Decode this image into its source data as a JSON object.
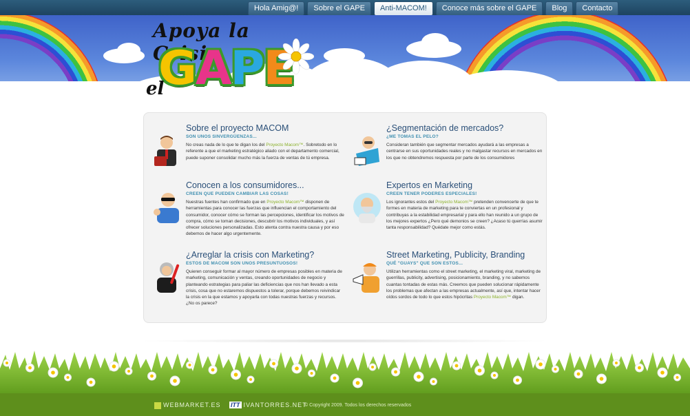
{
  "nav": {
    "items": [
      {
        "label": "Hola Amig@!"
      },
      {
        "label": "Sobre el GAPE"
      },
      {
        "label": "Anti-MACOM!"
      },
      {
        "label": "Conoce más sobre el GAPE"
      },
      {
        "label": "Blog"
      },
      {
        "label": "Contacto"
      }
    ],
    "active_index": 2
  },
  "logo": {
    "line1": "Apoya la Crisis",
    "prefix": "el",
    "word": "GAPE"
  },
  "items": [
    {
      "title": "Sobre el proyecto MACOM",
      "subtitle": "SON UNOS SINVERGÜENZAS...",
      "text_before": "No creas nada de lo que te digan los del ",
      "highlight": "Proyecto Macom™",
      "text_after": ". Sobretodo en lo referente a que el marketing estratégico aliado con el departamento comercial, puede suponer consolidar mucho más la fuerza de ventas de tú empresa."
    },
    {
      "title": "¿Segmentación de mercados?",
      "subtitle": "¿ME TOMAS EL PELO?",
      "text_before": "Consideran también que segmentar mercados ayudará a las empresas a centrarse en sus oportunidades reales y no malgastar recursos en mercados en los que no obtendremos respuesta por parte de los consumidores",
      "highlight": "",
      "text_after": ""
    },
    {
      "title": "Conocen a los consumidores...",
      "subtitle": "CREEN QUE PUEDEN CAMBIAR LAS COSAS!",
      "text_before": "Nuestras fuentes han confirmado que en ",
      "highlight": "Proyecto Macom™",
      "text_after": " disponen de herramientas para conocer las fuerzas que influencian el comportamiento del consumidor, conocer cómo se forman las percepciones, identificar los motivos de compra, cómo se toman decisiones, descubrir los motivos individuales, y así ofrecer soluciones personalizadas. Esto atenta contra nuestra causa y por eso debemos de hacer algo urgentemente."
    },
    {
      "title": "Expertos en Marketing",
      "subtitle": "CREEN TENER PODERES ESPECIALES!",
      "text_before": "Los ignorantes estos del ",
      "highlight": "Proyecto Macom™",
      "text_after": " pretenden convencerte de que te formes en materia de marketing para te conviertas en un profesional y contribuyas a la estabilidad empresarial y para ello han reunido a un grupo de los mejores expertos ¿Pero qué demonios se creen? ¿Acaso tú querrías asumir tanta responsabilidad? Quédate mejor como estás."
    },
    {
      "title": "¿Arreglar la crisis con Marketing?",
      "subtitle": "ESTOS DE MACOM SON UNOS PRESUNTUOSOS!",
      "text_before": "Quieren conseguir formar al mayor número de empresas posibles en materia de marketing, comunicación y ventas, creando oportunidades de negocio y planteando estrategias para paliar las deficiencias que nos han llevado a esta crisis, cosa que no estaremos dispuestos a tolerar, porque debemos reivindicar la crisis en la que estamos y apoyarla con todas nuestras fuerzas y recursos. ¿No os parece?",
      "highlight": "",
      "text_after": ""
    },
    {
      "title": "Street Marketing, Publicity, Branding",
      "subtitle": "QUÉ \"GUAYS\" QUE SON ESTOS...",
      "text_before": "Utilizan herramientas como el street marketing, el marketing viral, marketing de guerrillas, publicity, advertising, posicionamiento, branding, y no sabemos cuantas tontadas de estas más. Creemos que pueden solucionar rápidamente los problemas que afectan a las empresas actualmente, así que, intentar hacer oídos sordos de todo lo que estos hipócritas ",
      "highlight": "Proyecto Macom™",
      "text_after": " digan."
    }
  ],
  "footer": {
    "logo1": "WEBMARKET.ES",
    "logo2_mark": "ITT",
    "logo2": "IVANTORRES.NET",
    "copyright": "© Copyright 2009. Todos los derechos reservados"
  },
  "colors": {
    "title_blue": "#2a4f78",
    "subtitle_teal": "#3f8fb0",
    "highlight_green": "#8ab02a",
    "footer_green": "#5e8f1c"
  }
}
